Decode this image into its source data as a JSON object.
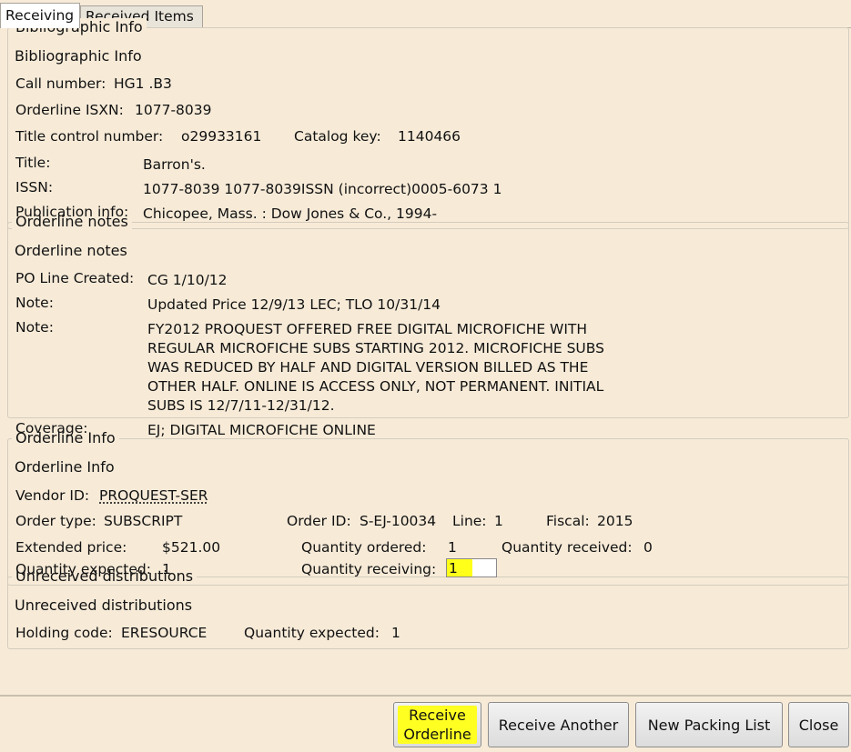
{
  "tabs": [
    "Receiving",
    "Received Items"
  ],
  "biblio": {
    "title": "Bibliographic Info",
    "call_number_label": "Call number:",
    "call_number": "HG1 .B3",
    "isxn_label": "Orderline ISXN:",
    "isxn": "1077-8039",
    "tcn_label": "Title control number:",
    "tcn": "o29933161",
    "catkey_label": "Catalog key:",
    "catkey": "1140466",
    "title_label": "Title:",
    "title_value": "Barron's.",
    "issn_label": "ISSN:",
    "issn": "1077-8039 1077-8039ISSN (incorrect)0005-6073 1",
    "pub_label": "Publication info:",
    "pub": "Chicopee, Mass. : Dow Jones & Co., 1994-"
  },
  "notes": {
    "title": "Orderline notes",
    "created_label": "PO Line Created:",
    "created": "CG 1/10/12",
    "note1_label": "Note:",
    "note1": "Updated Price 12/9/13 LEC; TLO 10/31/14",
    "note2_label": "Note:",
    "note2_lines": [
      "FY2012 PROQUEST OFFERED FREE DIGITAL MICROFICHE WITH",
      "REGULAR MICROFICHE SUBS STARTING 2012. MICROFICHE SUBS",
      "WAS REDUCED BY HALF AND DIGITAL VERSION BILLED AS THE",
      "OTHER HALF. ONLINE IS ACCESS ONLY, NOT PERMANENT. INITIAL",
      "SUBS IS 12/7/11-12/31/12."
    ],
    "coverage_label": "Coverage:",
    "coverage": "EJ; DIGITAL MICROFICHE ONLINE"
  },
  "orderline": {
    "title": "Orderline Info",
    "vendor_label": "Vendor ID:",
    "vendor": "PROQUEST-SER",
    "type_label": "Order type:",
    "type": "SUBSCRIPT",
    "orderid_label": "Order ID:",
    "orderid": "S-EJ-10034",
    "line_label": "Line:",
    "line": "1",
    "fiscal_label": "Fiscal:",
    "fiscal": "2015",
    "price_label": "Extended price:",
    "price": "$521.00",
    "qty_ordered_label": "Quantity ordered:",
    "qty_ordered": "1",
    "qty_received_label": "Quantity received:",
    "qty_received": "0",
    "qty_expected_label": "Quantity expected:",
    "qty_expected": "1",
    "qty_receiving_label": "Quantity receiving:",
    "qty_receiving": "1"
  },
  "unreceived": {
    "title": "Unreceived distributions",
    "holding_label": "Holding code:",
    "holding": "ERESOURCE",
    "qty_expected_label": "Quantity expected:",
    "qty_expected": "1"
  },
  "buttons": {
    "receive_line1": "Receive",
    "receive_line2": "Orderline",
    "receive_another": "Receive Another",
    "new_packing_list": "New Packing List",
    "close": "Close"
  }
}
